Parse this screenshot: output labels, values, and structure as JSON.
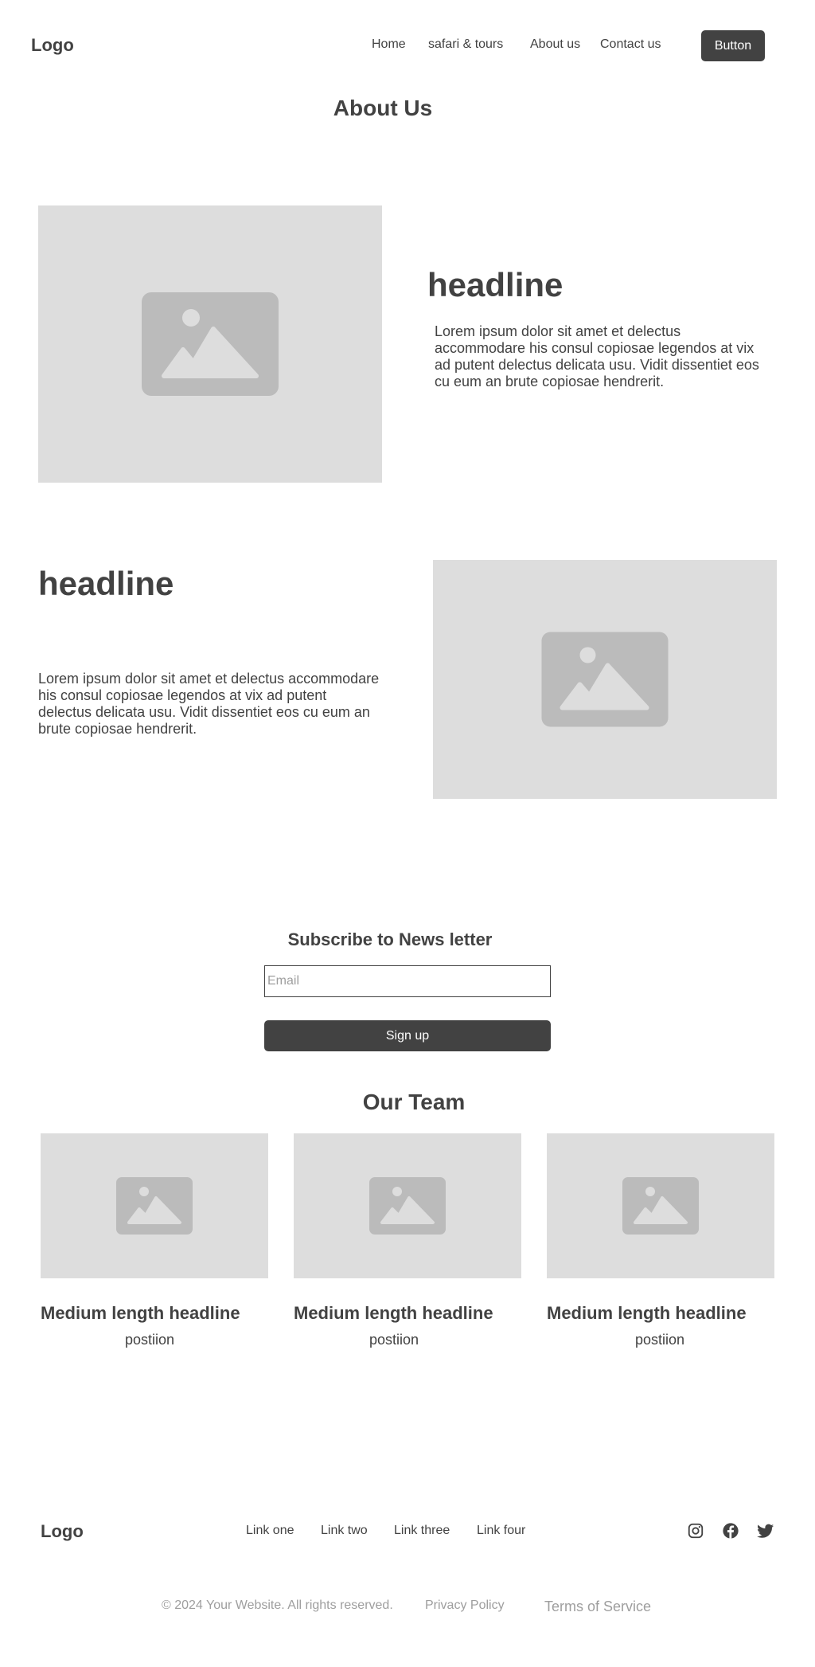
{
  "header": {
    "logo": "Logo",
    "nav": [
      "Home",
      "safari & tours",
      "About us",
      "Contact us"
    ],
    "button_label": "Button"
  },
  "page_title": "About Us",
  "section_one": {
    "headline": "headline",
    "body": "Lorem ipsum dolor sit amet et delectus accommodare his consul copiosae legendos at vix ad putent delectus delicata usu. Vidit dissentiet eos cu eum an brute copiosae hendrerit."
  },
  "section_two": {
    "headline": "headline",
    "body": "Lorem ipsum dolor sit amet et delectus accommodare his consul copiosae legendos at vix ad putent delectus delicata usu. Vidit dissentiet eos cu eum an brute copiosae hendrerit."
  },
  "newsletter": {
    "title": "Subscribe to News letter",
    "email_placeholder": "Email",
    "signup_label": "Sign up"
  },
  "team": {
    "title": "Our Team",
    "members": [
      {
        "headline": "Medium length headline",
        "position": "postiion"
      },
      {
        "headline": "Medium length headline",
        "position": "postiion"
      },
      {
        "headline": "Medium length headline",
        "position": "postiion"
      }
    ]
  },
  "footer": {
    "logo": "Logo",
    "links": [
      "Link one",
      "Link two",
      "Link three",
      "Link four"
    ],
    "social_icons": [
      "instagram-icon",
      "facebook-icon",
      "twitter-icon"
    ],
    "copyright": "© 2024 Your Website. All rights reserved.",
    "privacy": "Privacy Policy",
    "terms": "Terms of Service"
  },
  "colors": {
    "text": "#424242",
    "placeholder_bg": "#dddddd",
    "placeholder_icon": "#bbbbbb",
    "muted_text": "#9e9e9e",
    "button_bg": "#424242"
  }
}
